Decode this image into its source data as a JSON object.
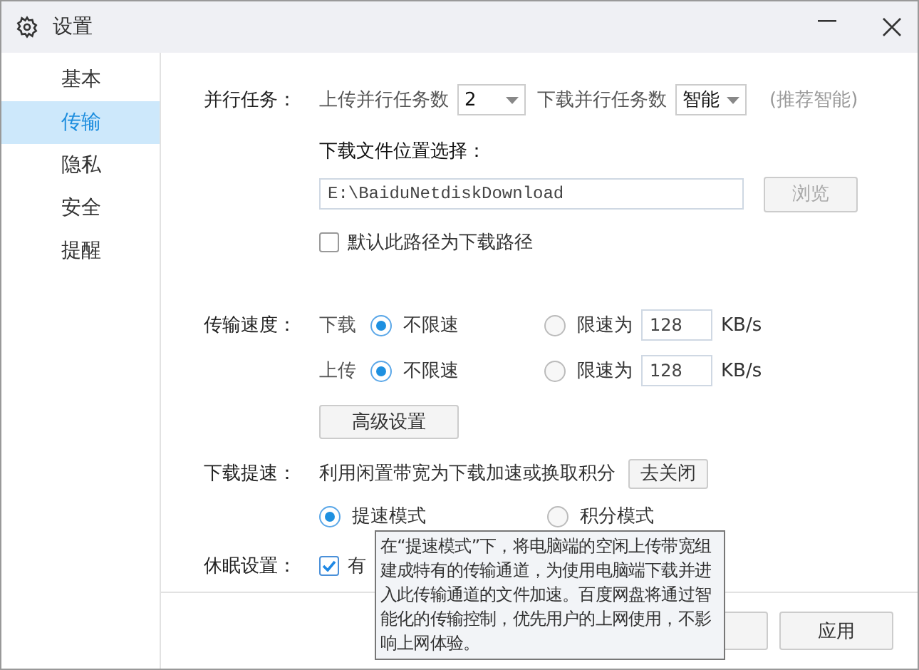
{
  "window": {
    "title": "设置"
  },
  "sidebar": {
    "items": [
      {
        "label": "基本",
        "selected": false
      },
      {
        "label": "传输",
        "selected": true
      },
      {
        "label": "隐私",
        "selected": false
      },
      {
        "label": "安全",
        "selected": false
      },
      {
        "label": "提醒",
        "selected": false
      }
    ]
  },
  "parallel": {
    "label": "并行任务：",
    "upload_label": "上传并行任务数",
    "upload_value": "2",
    "download_label": "下载并行任务数",
    "download_value": "智能",
    "hint": "(推荐智能)"
  },
  "download_location": {
    "label": "下载文件位置选择：",
    "path": "E:\\BaiduNetdiskDownload",
    "browse": {
      "label": "浏览",
      "disabled": true
    },
    "default_checkbox": {
      "label": "默认此路径为下载路径",
      "checked": false
    }
  },
  "speed": {
    "label": "传输速度：",
    "rows": [
      {
        "direction": "下载",
        "options": [
          {
            "label": "不限速",
            "selected": true
          },
          {
            "label": "限速为",
            "selected": false
          }
        ],
        "limit_value": "128",
        "unit": "KB/s"
      },
      {
        "direction": "上传",
        "options": [
          {
            "label": "不限速",
            "selected": true
          },
          {
            "label": "限速为",
            "selected": false
          }
        ],
        "limit_value": "128",
        "unit": "KB/s"
      }
    ],
    "advanced": "高级设置"
  },
  "boost": {
    "label": "下载提速：",
    "description": "利用闲置带宽为下载加速或换取积分",
    "close_button": "去关闭",
    "modes": [
      {
        "label": "提速模式",
        "selected": true
      },
      {
        "label": "积分模式",
        "selected": false
      }
    ]
  },
  "sleep": {
    "label": "休眠设置：",
    "checkbox": {
      "label": "有",
      "checked": true
    }
  },
  "tooltip": {
    "text": "在“提速模式”下，将电脑端的空闲上传带宽组建成特有的传输通道，为使用电脑端下载并进入此传输通道的文件加速。百度网盘将通过智能化的传输控制，优先用户的上网使用，不影响上网体验。"
  },
  "footer": {
    "apply": "应用"
  }
}
